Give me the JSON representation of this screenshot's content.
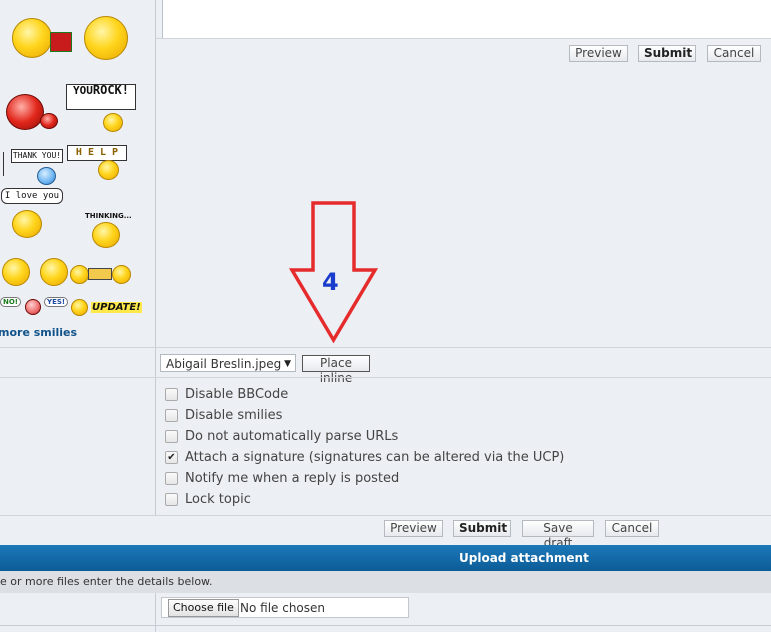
{
  "editor": {
    "preview": "Preview",
    "submit": "Submit",
    "cancel": "Cancel"
  },
  "smilies": {
    "sign_you_rock_top": "YOU",
    "sign_you_rock_bottom": "ROCK!",
    "sign_thank_you": "THANK YOU!",
    "sign_help": "H E L P",
    "bubble_i_love_you": "I love you",
    "thinking": "THINKING...",
    "sign_no": "NO!",
    "sign_yes": "YES!",
    "update": "UPDATE!",
    "more_link": "more smilies"
  },
  "annotation": {
    "step_number": "4",
    "arrow_color": "#e52b2b",
    "number_color": "#1a3ccc"
  },
  "attachment_select": {
    "selected": "Abigail Breslin.jpeg",
    "place_inline": "Place inline"
  },
  "options": [
    {
      "label": "Disable BBCode",
      "checked": false
    },
    {
      "label": "Disable smilies",
      "checked": false
    },
    {
      "label": "Do not automatically parse URLs",
      "checked": false
    },
    {
      "label": "Attach a signature (signatures can be altered via the UCP)",
      "checked": true
    },
    {
      "label": "Notify me when a reply is posted",
      "checked": false
    },
    {
      "label": "Lock topic",
      "checked": false
    }
  ],
  "bottom_buttons": {
    "preview": "Preview",
    "submit": "Submit",
    "save_draft": "Save draft",
    "cancel": "Cancel"
  },
  "upload": {
    "title": "Upload attachment",
    "hint": "e or more files enter the details below.",
    "choose_file": "Choose file",
    "no_file": "No file chosen"
  },
  "colors": {
    "header_bar": "#0f6aa8",
    "link": "#105289"
  }
}
